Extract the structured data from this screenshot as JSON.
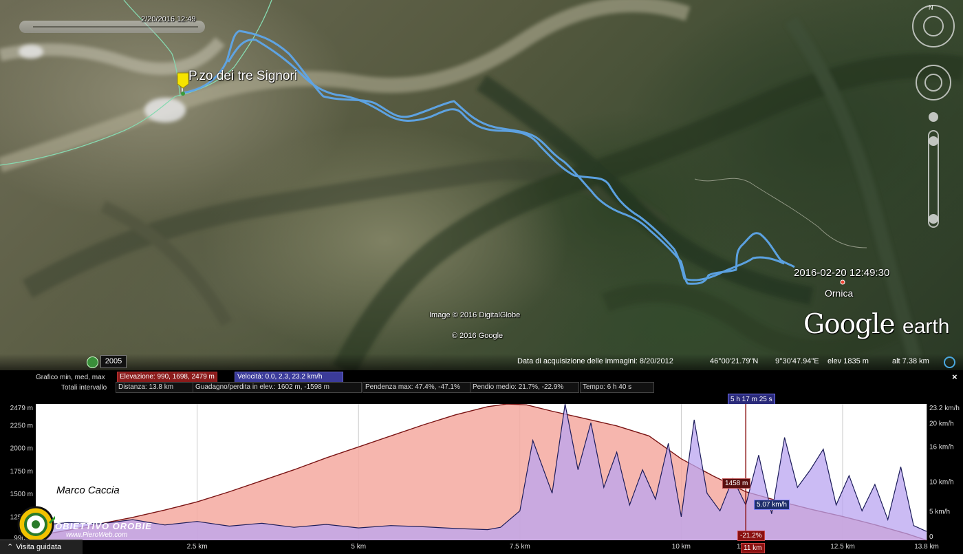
{
  "map": {
    "slider_date": "2/20/2016  12:49",
    "peak_label": "P.zo dei tre Signori",
    "track_end_label": "2016-02-20 12:49:30",
    "town_label": "Ornica",
    "copyright_imagery": "Image © 2016 DigitalGlobe",
    "copyright_google": "© 2016 Google",
    "brand_google": "Google",
    "brand_earth": "earth",
    "track_color": "#5aa0e6",
    "border_color": "#7fd4a8"
  },
  "statusbar": {
    "history_year": "2005",
    "acquisition": "Data di acquisizione delle immagini: 8/20/2012",
    "lat": "46°00'21.79\"N",
    "lon": "9°30'47.94\"E",
    "elev": "elev  1835 m",
    "alt": "alt   7.38 km"
  },
  "profile": {
    "graph_label": "Grafico  min, med, max",
    "elevation_box": "Elevazione: 990, 1698, 2479 m",
    "speed_box": "Velocità: 0.0, 2.3, 23.2 km/h",
    "totals_label": "Totali intervallo",
    "distance_box": "Distanza: 13.8 km",
    "gain_box": "Guadagno/perdita in elev.: 1602 m, -1598 m",
    "slope_max_box": "Pendenza max: 47.4%, -47.1%",
    "slope_avg_box": "Pendio medio: 21.7%, -22.9%",
    "time_box": "Tempo: 6 h 40 s",
    "time_badge": "5 h 17 m 25 s",
    "close": "×",
    "cursor_elev": "1458 m",
    "cursor_speed": "5.07 km/h",
    "cursor_slope": "-21.2%",
    "cursor_dist": "11 km",
    "author": "Marco Caccia",
    "logo_text": "OBIETTIVO OROBIE",
    "logo_url": "www.PieroWeb.com",
    "tour_label": "Visita guidata"
  },
  "chart_data": {
    "type": "area",
    "x_unit": "km",
    "xlim": [
      0,
      13.8
    ],
    "x_ticks": [
      "2.5 km",
      "5 km",
      "7.5 km",
      "10 km",
      "11 km",
      "12.5 km",
      "13.8 km"
    ],
    "y_left_unit": "m",
    "y_left_ticks": [
      "990 m",
      "1250 m",
      "1500 m",
      "1750 m",
      "2000 m",
      "2250 m",
      "2479 m"
    ],
    "y_left_lim": [
      990,
      2479
    ],
    "y_right_unit": "km/h",
    "y_right_ticks": [
      "0",
      "5 km/h",
      "10 km/h",
      "16 km/h",
      "20 km/h",
      "23.2 km/h"
    ],
    "y_right_lim": [
      0,
      23.2
    ],
    "series": [
      {
        "name": "Elevazione",
        "color": "#f4a9a0",
        "x": [
          0,
          0.5,
          1,
          1.5,
          2,
          2.5,
          3,
          3.5,
          4,
          4.5,
          5,
          5.5,
          6,
          6.5,
          7,
          7.3,
          7.6,
          8,
          8.5,
          9,
          9.5,
          10,
          10.5,
          11,
          11.5,
          12,
          12.5,
          13,
          13.5,
          13.8
        ],
        "y": [
          1040,
          1100,
          1170,
          1240,
          1320,
          1410,
          1520,
          1640,
          1760,
          1890,
          2010,
          2130,
          2250,
          2360,
          2450,
          2479,
          2470,
          2400,
          2320,
          2240,
          2130,
          1880,
          1690,
          1520,
          1420,
          1330,
          1250,
          1160,
          1060,
          990
        ]
      },
      {
        "name": "Velocità",
        "color": "#b9a4f0",
        "x": [
          0,
          0.5,
          1,
          1.5,
          2,
          2.5,
          3,
          3.5,
          4,
          4.5,
          5,
          5.5,
          6,
          6.5,
          7,
          7.2,
          7.5,
          7.7,
          8,
          8.2,
          8.4,
          8.6,
          8.8,
          9,
          9.2,
          9.4,
          9.6,
          9.8,
          10,
          10.2,
          10.4,
          10.6,
          10.8,
          11,
          11.2,
          11.4,
          11.6,
          11.8,
          12,
          12.2,
          12.4,
          12.6,
          12.8,
          13,
          13.2,
          13.4,
          13.6,
          13.8
        ],
        "y": [
          2.5,
          3.0,
          2.8,
          3.5,
          2.6,
          3.2,
          2.4,
          2.9,
          2.2,
          2.7,
          2.1,
          2.5,
          2.3,
          2.0,
          1.8,
          2.2,
          5.0,
          17.0,
          8.0,
          23.2,
          12.0,
          20.0,
          9.0,
          15.0,
          6.0,
          12.0,
          7.0,
          16.5,
          4.0,
          20.5,
          8.0,
          5.0,
          10.5,
          6.0,
          14.5,
          4.5,
          17.5,
          9.0,
          12.0,
          15.5,
          6.0,
          11.0,
          5.0,
          9.5,
          3.5,
          12.5,
          2.5,
          1.5
        ]
      }
    ]
  }
}
